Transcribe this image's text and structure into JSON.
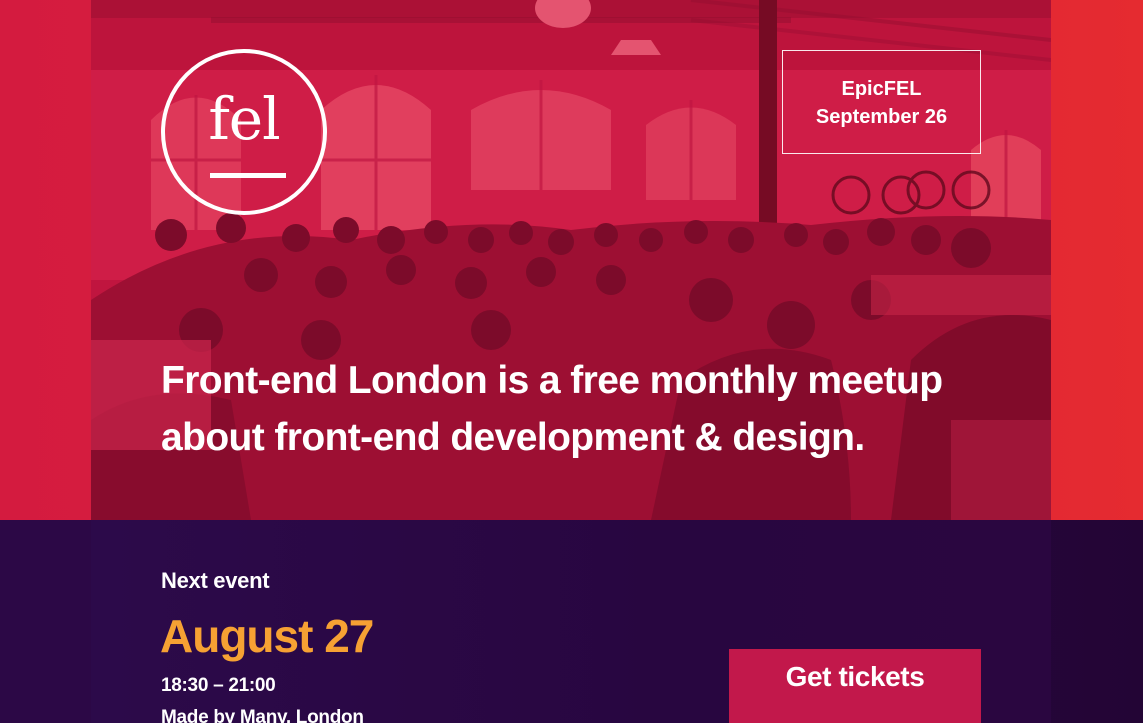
{
  "colors": {
    "hero_red": "#dc1f3f",
    "event_bg": "#2a0843",
    "date_orange": "#f6a133",
    "ticket_button": "#c2184b"
  },
  "logo": {
    "text": "fel",
    "icon": "fel-circle-logo"
  },
  "special_event": {
    "name": "EpicFEL",
    "date": "September 26"
  },
  "hero": {
    "tagline": "Front-end London is a free monthly meetup about front-end development & design."
  },
  "next_event": {
    "label": "Next event",
    "date": "August 27",
    "time": "18:30 – 21:00",
    "venue": "Made by Many, London",
    "tickets_label": "Get tickets"
  }
}
